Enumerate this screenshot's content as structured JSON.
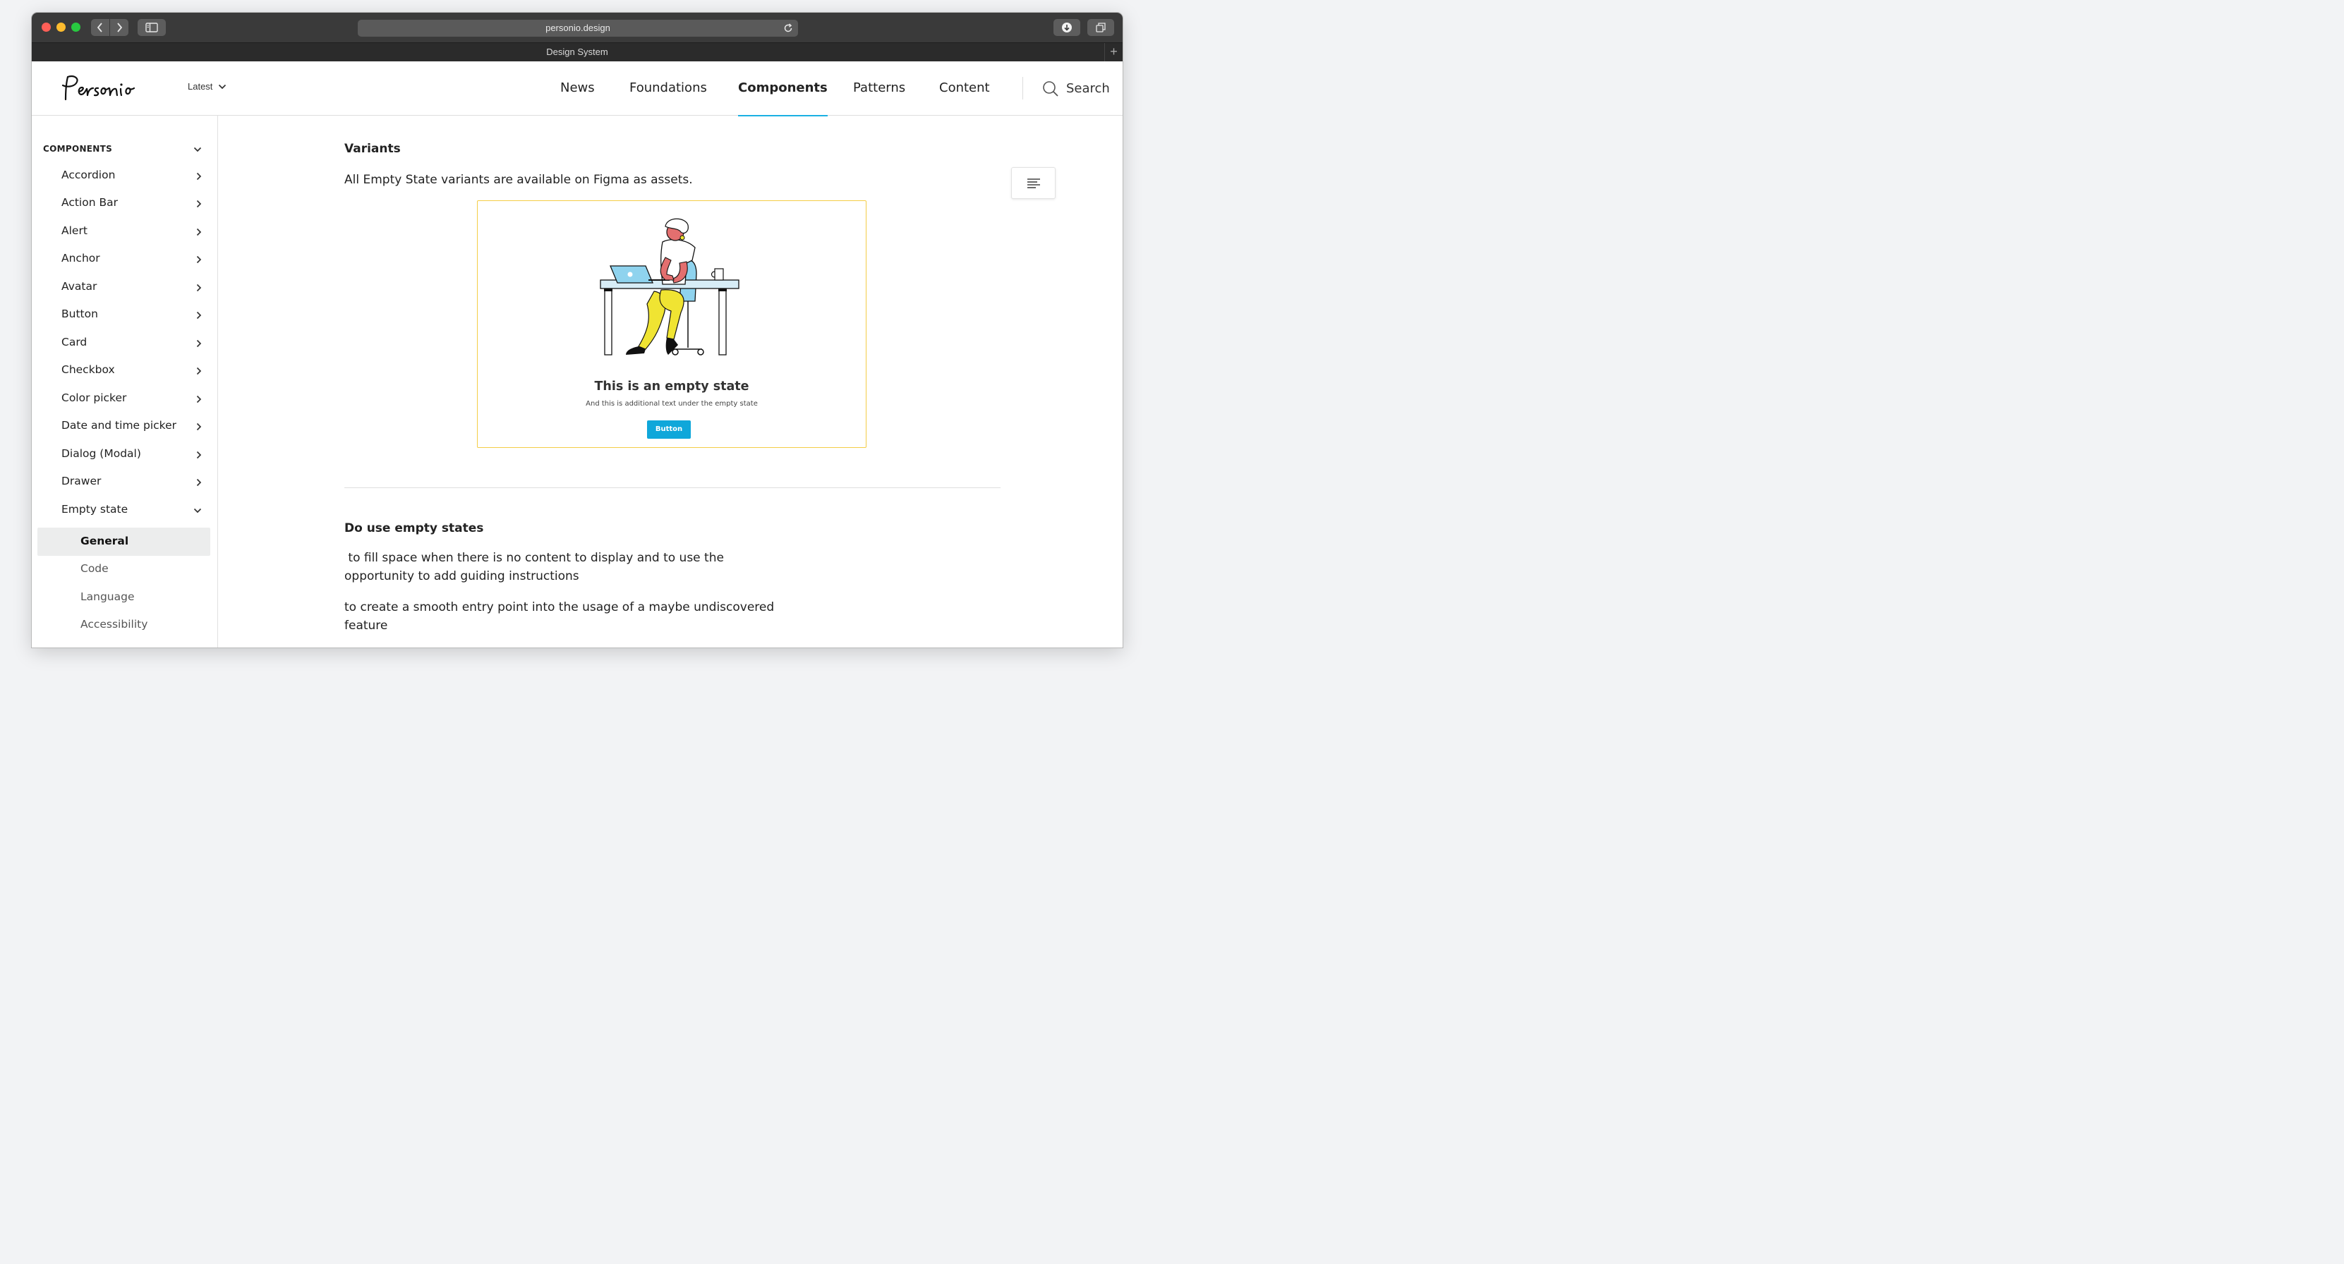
{
  "browser": {
    "url": "personio.design",
    "tab_title": "Design System"
  },
  "header": {
    "version_label": "Latest",
    "nav": [
      {
        "label": "News"
      },
      {
        "label": "Foundations"
      },
      {
        "label": "Components",
        "active": true
      },
      {
        "label": "Patterns"
      },
      {
        "label": "Content"
      }
    ],
    "search_label": "Search"
  },
  "sidebar": {
    "section_title": "COMPONENTS",
    "items": [
      {
        "label": "Accordion"
      },
      {
        "label": "Action Bar"
      },
      {
        "label": "Alert"
      },
      {
        "label": "Anchor"
      },
      {
        "label": "Avatar"
      },
      {
        "label": "Button"
      },
      {
        "label": "Card"
      },
      {
        "label": "Checkbox"
      },
      {
        "label": "Color picker"
      },
      {
        "label": "Date and time picker"
      },
      {
        "label": "Dialog (Modal)"
      },
      {
        "label": "Drawer"
      },
      {
        "label": "Empty state",
        "expanded": true
      }
    ],
    "subitems": [
      {
        "label": "General",
        "active": true
      },
      {
        "label": "Code"
      },
      {
        "label": "Language"
      },
      {
        "label": "Accessibility"
      }
    ]
  },
  "content": {
    "variants_heading": "Variants",
    "variants_text": "All Empty State variants are available on Figma as assets.",
    "demo": {
      "title": "This is an empty state",
      "subtitle": "And this is additional text under the empty state",
      "button_label": "Button"
    },
    "do_heading": "Do use empty states",
    "do_items": [
      " to fill space when there is no content to display and to use the opportunity to add guiding instructions",
      "to create a smooth entry point into the usage of a maybe undiscovered feature"
    ]
  },
  "colors": {
    "accent": "#1bb0e3",
    "demo_border": "#f4cd46",
    "demo_button": "#0fa7da"
  }
}
